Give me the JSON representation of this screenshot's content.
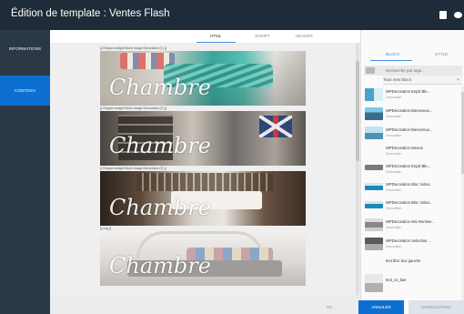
{
  "header": {
    "title": "Édition de template : Ventes Flash",
    "icons": [
      "document-icon",
      "eye-icon"
    ]
  },
  "nav": {
    "items": [
      {
        "label": "INFORMATIONS",
        "active": false
      },
      {
        "label": "CONTENU",
        "active": true
      }
    ]
  },
  "editor": {
    "tabs": [
      {
        "label": "HTML",
        "active": true
      },
      {
        "label": "SCRIPT",
        "active": false
      },
      {
        "label": "HEADER",
        "active": false
      }
    ],
    "blocks": [
      {
        "caption": "{{ Elegant.widget.Block.Image.Decoration (1) }}",
        "word": "Chambre"
      },
      {
        "caption": "{{ Elegant.widget.Block.Image.Decoration (2) }}",
        "word": "Chambre"
      },
      {
        "caption": "{{ Elegant.widget.Block.Image.Decoration (3) }}",
        "word": "Chambre"
      },
      {
        "caption": "{{ img }}",
        "word": "Chambre"
      }
    ]
  },
  "panel": {
    "tabs": [
      {
        "label": "BLOCS",
        "active": true
      },
      {
        "label": "STYLE",
        "active": false
      }
    ],
    "search_placeholder": "Recherche par tags...",
    "filter_value": "Tous mes blocs",
    "items": [
      {
        "name": "WPDecoration Enjoli Ble...",
        "category": "Decoration"
      },
      {
        "name": "WPDecoration Bienvenue...",
        "category": "Decoration"
      },
      {
        "name": "WPDecoration Bienvenue...",
        "category": "Decoration"
      },
      {
        "name": "WPDecoration Menus",
        "category": "Decoration"
      },
      {
        "name": "WPDecoration Enjoli Ble...",
        "category": "Decoration"
      },
      {
        "name": "WPDecoration Bloc Video...",
        "category": "Decoration"
      },
      {
        "name": "WPDecoration Bloc Video...",
        "category": "Decoration"
      },
      {
        "name": "WPDecoration Mix Remise...",
        "category": "Decoration"
      },
      {
        "name": "WPDecoration Selection ...",
        "category": "Decoration"
      },
      {
        "name": "text bloc box gauche",
        "category": ""
      },
      {
        "name": "text_cs_bas",
        "category": ""
      }
    ]
  },
  "actions": {
    "ok": "OK",
    "cancel": "ANNULER",
    "save": "ENREGISTRER"
  }
}
